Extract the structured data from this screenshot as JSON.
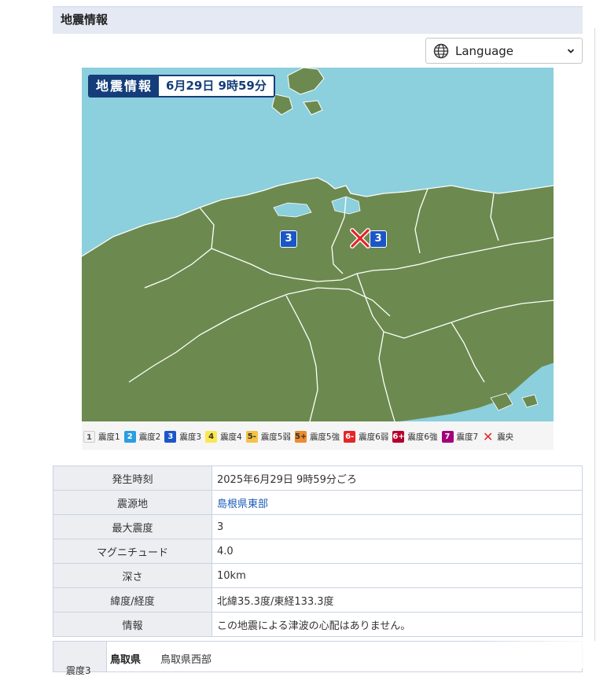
{
  "section": {
    "title": "地震情報"
  },
  "language": {
    "label": "Language",
    "icon": "globe-icon"
  },
  "map": {
    "badge_title": "地震情報",
    "badge_time": "6月29日 9時59分",
    "colors": {
      "sea": "#8ccfdd",
      "land": "#6c8a4f",
      "border": "#ffffff"
    },
    "markers": [
      {
        "value": "3",
        "color": "#1a56c8"
      },
      {
        "value": "3",
        "color": "#1a56c8"
      }
    ],
    "epicenter_icon": "epicenter-x-icon"
  },
  "legend": [
    {
      "symbol": "1",
      "label": "震度1",
      "bg": "#f2f2f2",
      "fg": "#555"
    },
    {
      "symbol": "2",
      "label": "震度2",
      "bg": "#2a9de4",
      "fg": "#ffffff"
    },
    {
      "symbol": "3",
      "label": "震度3",
      "bg": "#1a56c8",
      "fg": "#ffffff"
    },
    {
      "symbol": "4",
      "label": "震度4",
      "bg": "#fbe84c",
      "fg": "#333"
    },
    {
      "symbol": "5-",
      "label": "震度5弱",
      "bg": "#f5c242",
      "fg": "#333"
    },
    {
      "symbol": "5+",
      "label": "震度5強",
      "bg": "#f08a2c",
      "fg": "#333"
    },
    {
      "symbol": "6-",
      "label": "震度6弱",
      "bg": "#e62525",
      "fg": "#ffffff"
    },
    {
      "symbol": "6+",
      "label": "震度6強",
      "bg": "#b5002c",
      "fg": "#ffffff"
    },
    {
      "symbol": "7",
      "label": "震度7",
      "bg": "#a3007a",
      "fg": "#ffffff"
    },
    {
      "symbol": "✕",
      "label": "震央",
      "bg": "transparent",
      "fg": "#e0262a"
    }
  ],
  "info_table": [
    {
      "key": "発生時刻",
      "value": "2025年6月29日 9時59分ごろ",
      "link": false
    },
    {
      "key": "震源地",
      "value": "島根県東部",
      "link": true
    },
    {
      "key": "最大震度",
      "value": "3",
      "link": false
    },
    {
      "key": "マグニチュード",
      "value": "4.0",
      "link": false
    },
    {
      "key": "深さ",
      "value": "10km",
      "link": false
    },
    {
      "key": "緯度/経度",
      "value": "北緯35.3度/東経133.3度",
      "link": false
    },
    {
      "key": "情報",
      "value": "この地震による津波の心配はありません。",
      "link": false
    }
  ],
  "intensity_table": {
    "level_label": "震度3",
    "prefecture": "鳥取県",
    "area": "鳥取県西部"
  }
}
